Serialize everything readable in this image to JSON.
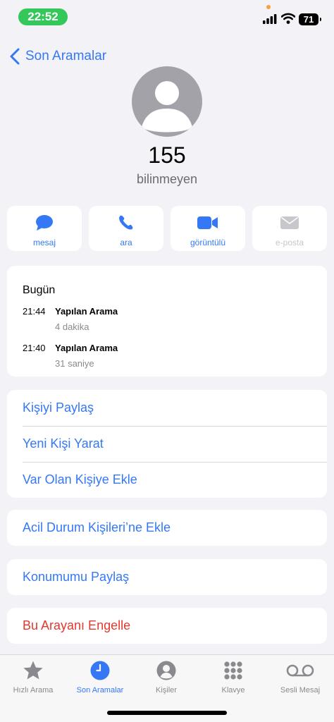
{
  "status_bar": {
    "time": "22:52",
    "battery": "71"
  },
  "nav": {
    "back_label": "Son Aramalar"
  },
  "contact": {
    "name": "155",
    "subtitle": "bilinmeyen"
  },
  "actions": [
    {
      "label": "mesaj",
      "icon": "message-icon"
    },
    {
      "label": "ara",
      "icon": "phone-icon"
    },
    {
      "label": "görüntülü",
      "icon": "video-icon"
    },
    {
      "label": "e-posta",
      "icon": "mail-icon",
      "disabled": true
    }
  ],
  "history": {
    "title": "Bugün",
    "calls": [
      {
        "time": "21:44",
        "type": "Yapılan Arama",
        "duration": "4 dakika"
      },
      {
        "time": "21:40",
        "type": "Yapılan Arama",
        "duration": "31 saniye"
      }
    ]
  },
  "menu": {
    "share_contact": "Kişiyi Paylaş",
    "new_contact": "Yeni Kişi Yarat",
    "add_existing": "Var Olan Kişiye Ekle",
    "emergency": "Acil Durum Kişileri’ne Ekle",
    "share_location": "Konumumu Paylaş",
    "block": "Bu Arayanı Engelle"
  },
  "tab_bar": {
    "items": [
      {
        "label": "Hızlı Arama",
        "icon": "star-icon"
      },
      {
        "label": "Son Aramalar",
        "icon": "clock-icon",
        "active": true
      },
      {
        "label": "Kişiler",
        "icon": "person-icon"
      },
      {
        "label": "Klavye",
        "icon": "keypad-icon"
      },
      {
        "label": "Sesli Mesaj",
        "icon": "voicemail-icon"
      }
    ]
  },
  "colors": {
    "accent": "#3478f6",
    "destructive": "#e2382f",
    "status_green": "#34c759",
    "background": "#f2f2f7"
  }
}
